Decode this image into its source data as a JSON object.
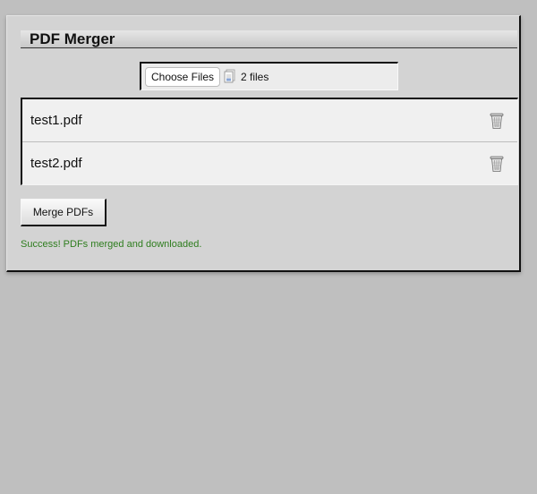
{
  "app": {
    "title": "PDF Merger"
  },
  "file_input": {
    "button_label": "Choose Files",
    "selection_text": "2 files",
    "icon": "document-stack-icon"
  },
  "files": [
    {
      "name": "test1.pdf",
      "icon": "trash-icon"
    },
    {
      "name": "test2.pdf",
      "icon": "trash-icon"
    }
  ],
  "actions": {
    "merge_label": "Merge PDFs"
  },
  "status": {
    "message": "Success! PDFs merged and downloaded.",
    "color": "#2e7d1e"
  }
}
